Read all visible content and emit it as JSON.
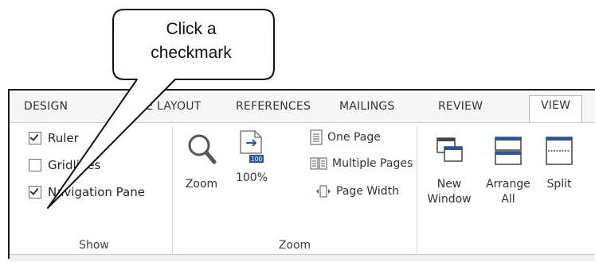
{
  "callout": {
    "text_line1": "Click a",
    "text_line2": "checkmark"
  },
  "tabs": [
    {
      "label": "DESIGN"
    },
    {
      "label": "PAGE LAYOUT"
    },
    {
      "label": "REFERENCES"
    },
    {
      "label": "MAILINGS"
    },
    {
      "label": "REVIEW"
    },
    {
      "label": "VIEW",
      "active": true
    }
  ],
  "show_group": {
    "label": "Show",
    "items": [
      {
        "label": "Ruler",
        "checked": true
      },
      {
        "label": "Gridlines",
        "checked": false
      },
      {
        "label": "Navigation Pane",
        "checked": true
      }
    ]
  },
  "zoom_group": {
    "label": "Zoom",
    "zoom_label": "Zoom",
    "zoom100_label": "100%",
    "zoom100_icon_text": "100",
    "one_page_label": "One Page",
    "multiple_pages_label": "Multiple Pages",
    "page_width_label": "Page Width"
  },
  "window_group": {
    "new_window_line1": "New",
    "new_window_line2": "Window",
    "arrange_all_line1": "Arrange",
    "arrange_all_line2": "All",
    "split_label": "Split"
  },
  "colors": {
    "accent": "#2b579a",
    "ribbon_bg": "#f5f6f7",
    "panel_bg": "#ffffff"
  }
}
